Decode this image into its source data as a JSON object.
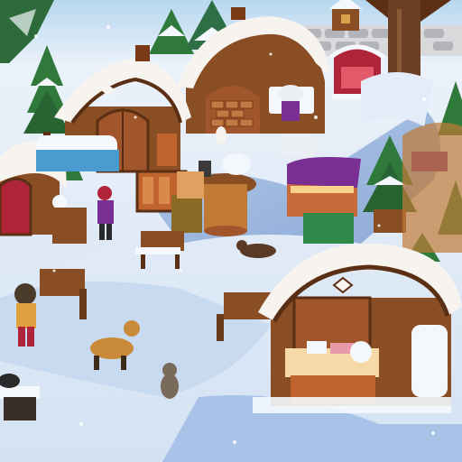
{
  "scene": {
    "kind": "winter-village-game-scene",
    "palette": {
      "snow": "#f4f8fd",
      "snow_shadow": "#b9cde8",
      "path_blue": "#8fb0dd",
      "wood": "#8a4e25",
      "wood_dark": "#5a2f14",
      "roof_snow": "#f7f4ef",
      "pine": "#2f7a3a",
      "door_red": "#b0243a",
      "awning_purple": "#7a2f95",
      "sky_top": "#b7d7ef",
      "trunk": "#6b4025"
    },
    "elements": [
      {
        "name": "cabin-top-left",
        "icon": "cabin-icon"
      },
      {
        "name": "cabin-center-large",
        "icon": "cabin-icon"
      },
      {
        "name": "bakery-hut-top",
        "icon": "stone-oven-hut-icon"
      },
      {
        "name": "red-shop-top-right",
        "icon": "shop-icon"
      },
      {
        "name": "cabin-left-red-door",
        "icon": "cabin-icon"
      },
      {
        "name": "cabin-bottom-right-stall",
        "icon": "market-stall-icon"
      },
      {
        "name": "market-table-center",
        "icon": "table-icon"
      },
      {
        "name": "benches",
        "icon": "bench-icon"
      },
      {
        "name": "pine-trees",
        "icon": "pine-tree-icon"
      },
      {
        "name": "villagers",
        "icon": "person-icon"
      },
      {
        "name": "dogs",
        "icon": "dog-icon"
      }
    ]
  }
}
